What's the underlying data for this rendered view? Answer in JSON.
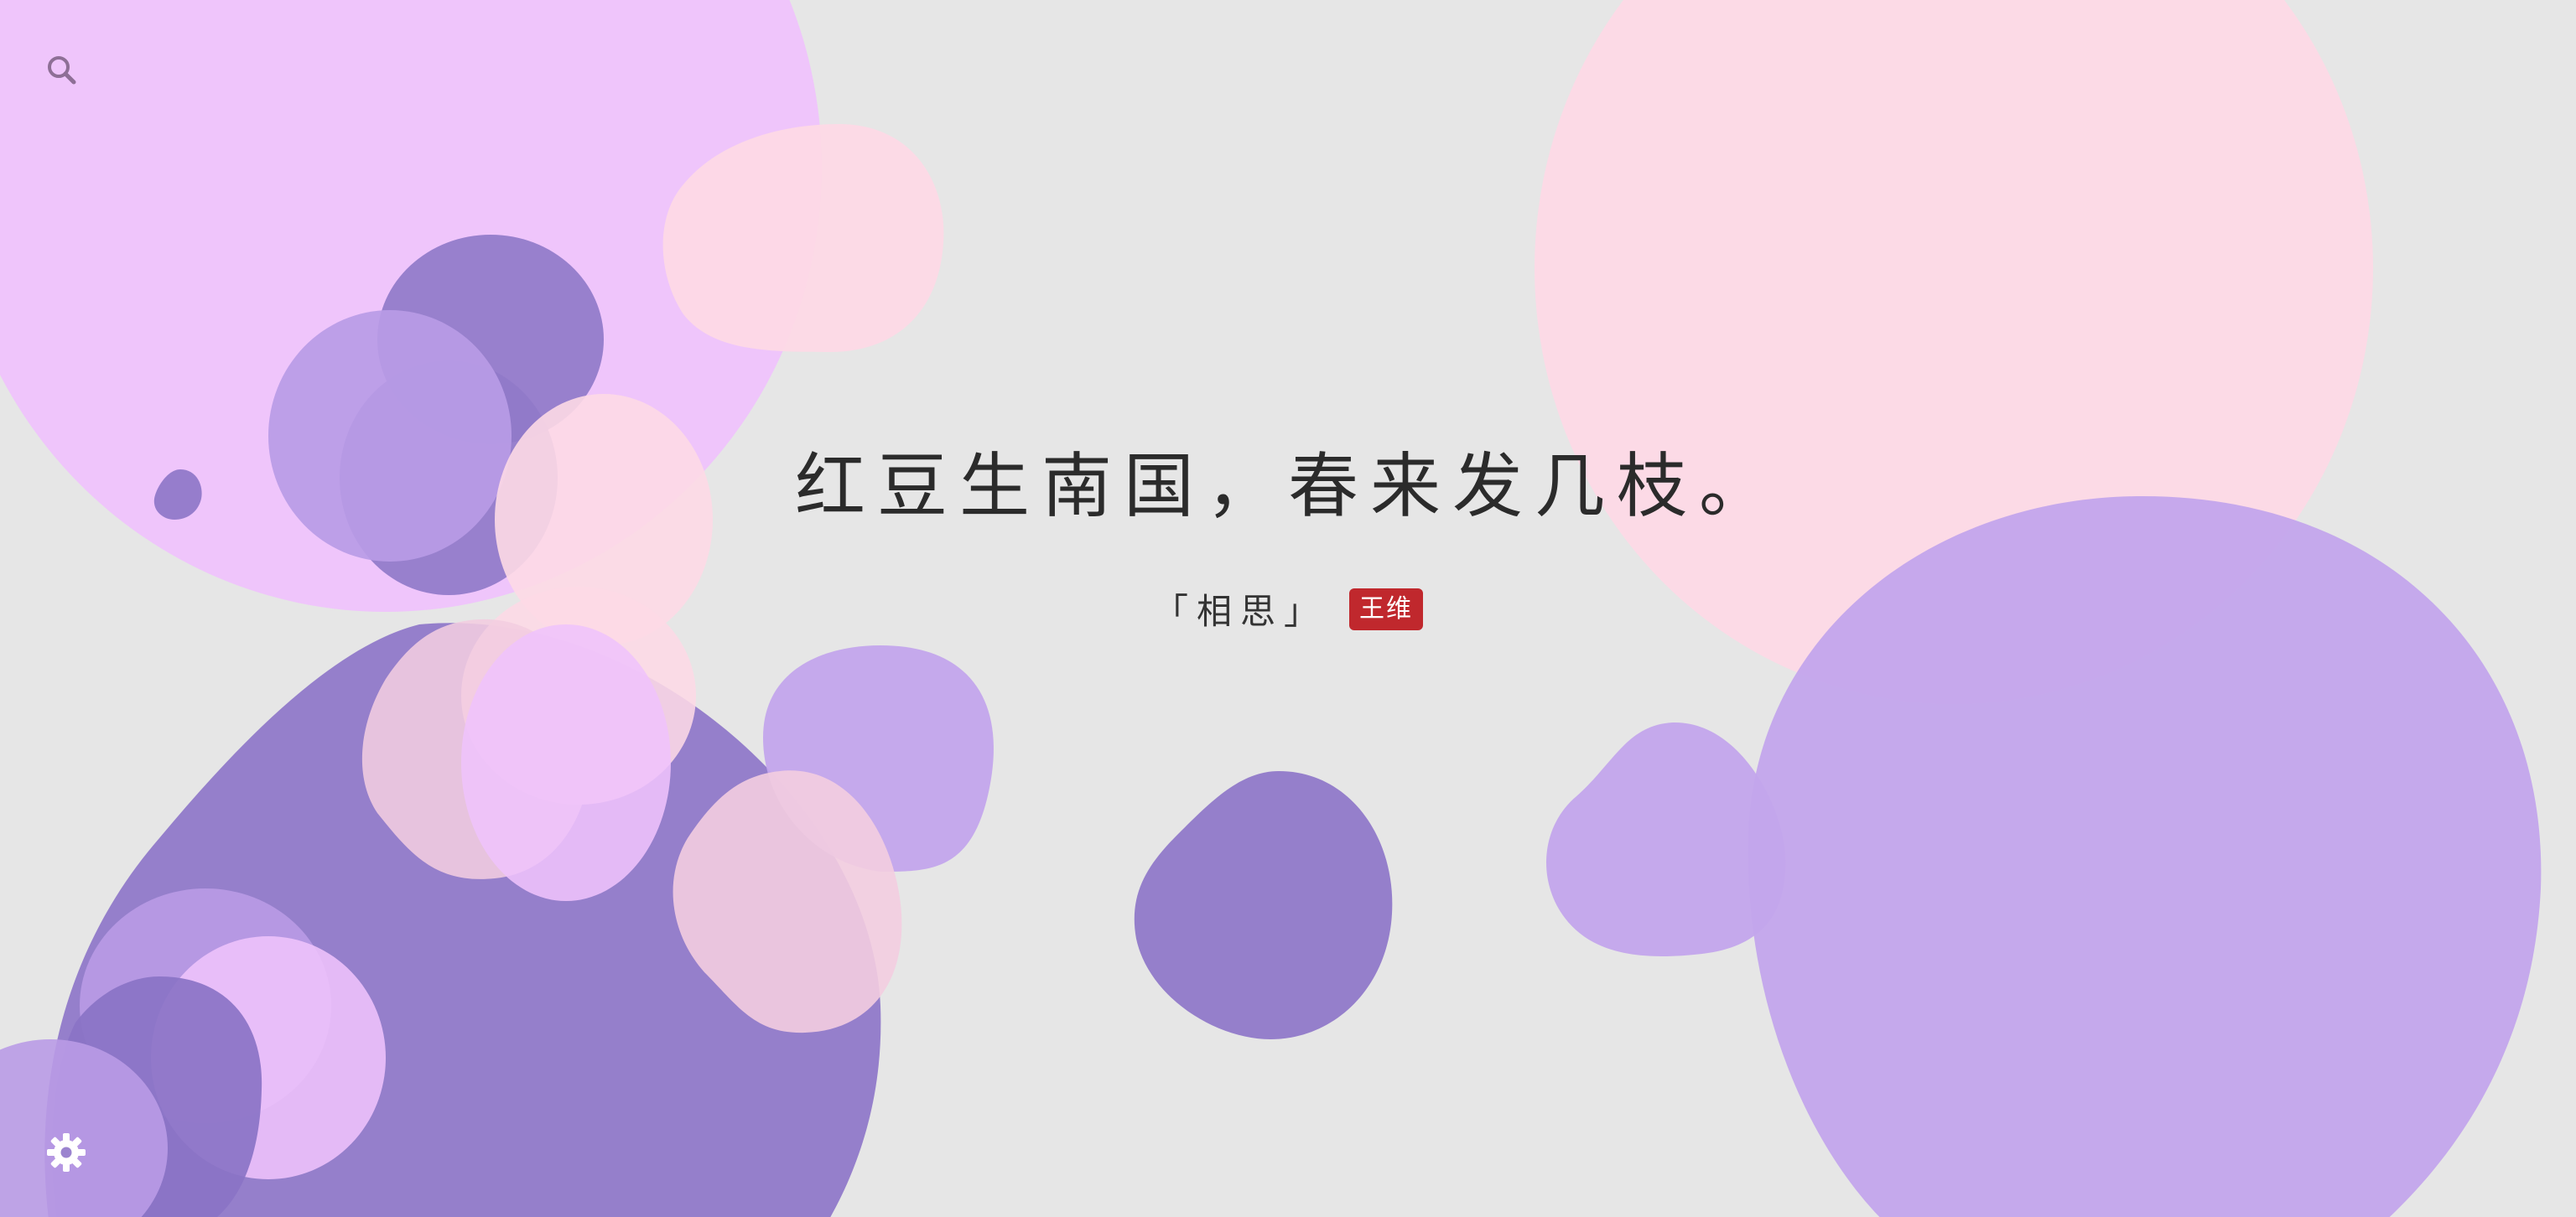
{
  "poem": {
    "line": "红豆生南国，春来发几枝。",
    "title": "「相思」",
    "author": "王维"
  },
  "icons": {
    "search": "search-icon",
    "settings": "gear-icon"
  },
  "colors": {
    "background": "#e6e6e6",
    "lilac": "#efc3fc",
    "pink": "#fdd9e6",
    "violet": "#9079c9",
    "lavender": "#c3a5ec",
    "author_badge": "#c0282d",
    "text": "#2b2b2b"
  }
}
